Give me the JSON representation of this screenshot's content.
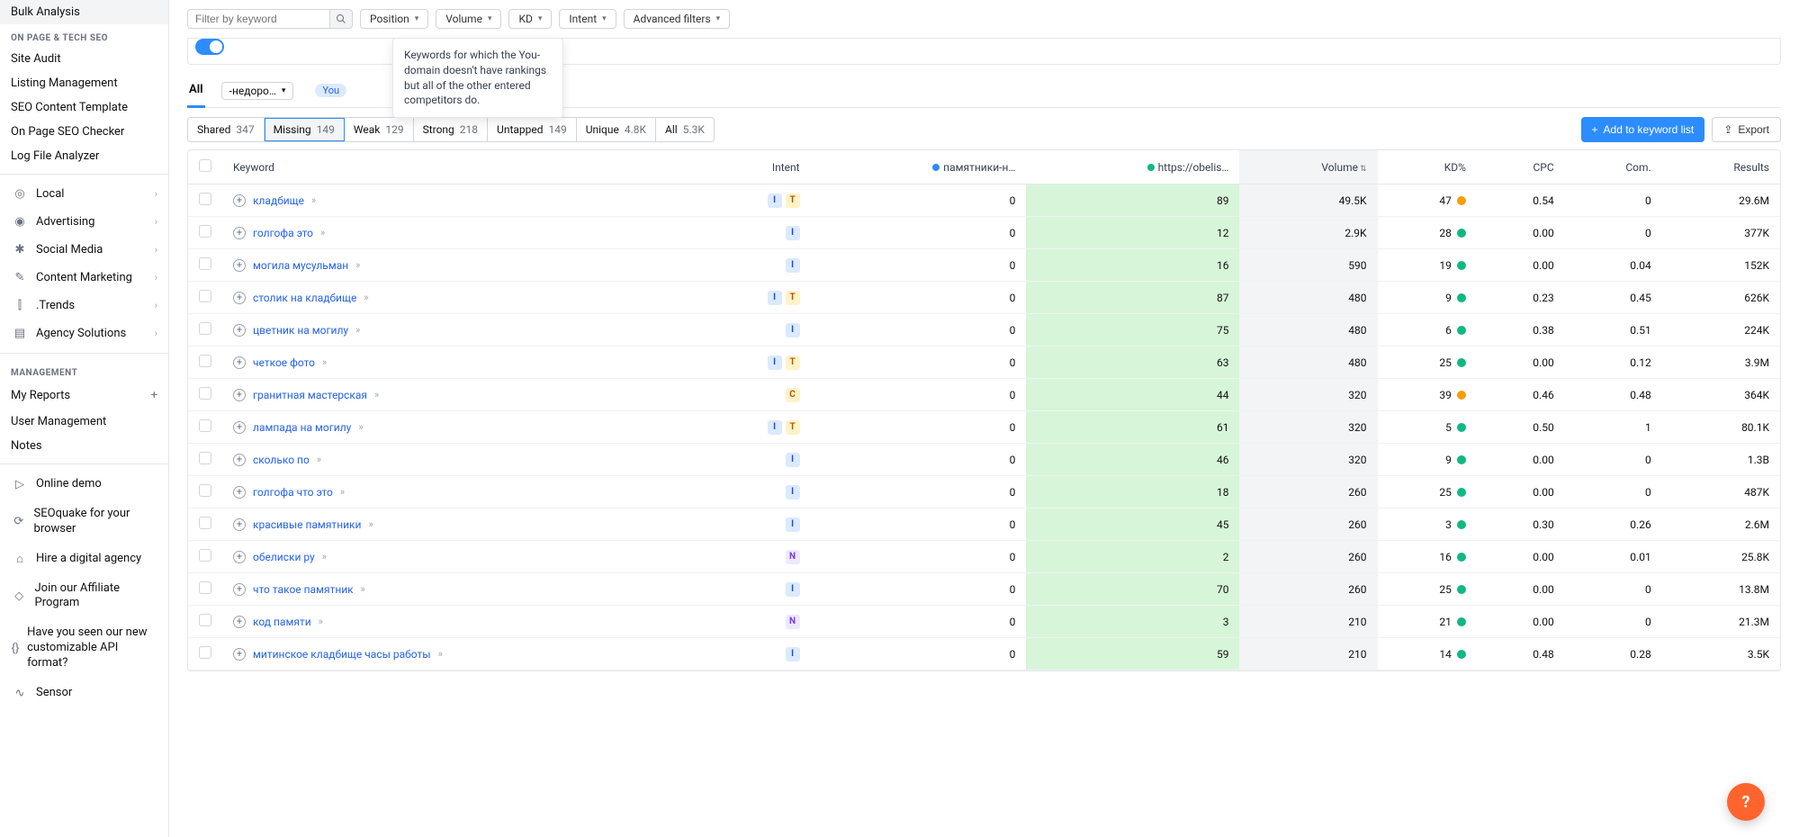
{
  "sidebar": {
    "top_items": [
      "Bulk Analysis"
    ],
    "section1_heading": "ON PAGE & TECH SEO",
    "section1_items": [
      "Site Audit",
      "Listing Management",
      "SEO Content Template",
      "On Page SEO Checker",
      "Log File Analyzer"
    ],
    "main_sections": [
      {
        "label": "Local",
        "icon": "pin"
      },
      {
        "label": "Advertising",
        "icon": "target"
      },
      {
        "label": "Social Media",
        "icon": "share"
      },
      {
        "label": "Content Marketing",
        "icon": "pencil"
      },
      {
        "label": ".Trends",
        "icon": "chart"
      },
      {
        "label": "Agency Solutions",
        "icon": "doc"
      }
    ],
    "management_heading": "MANAGEMENT",
    "management_items": [
      "My Reports",
      "User Management",
      "Notes"
    ],
    "footer_items": [
      "Online demo",
      "SEOquake for your browser",
      "Hire a digital agency",
      "Join our Affiliate Program",
      "Have you seen our new customizable API format?",
      "Sensor"
    ]
  },
  "toolbar": {
    "filter_placeholder": "Filter by keyword",
    "pills": [
      "Position",
      "Volume",
      "KD",
      "Intent",
      "Advanced filters"
    ]
  },
  "tooltip_text": "Keywords for which the You-domain doesn't have rankings but all of the other entered competitors do.",
  "tabs": {
    "all_label": "All",
    "domain_label": "-недоро…",
    "you_label": "You"
  },
  "segments": [
    {
      "label": "Shared",
      "count": "347"
    },
    {
      "label": "Missing",
      "count": "149"
    },
    {
      "label": "Weak",
      "count": "129"
    },
    {
      "label": "Strong",
      "count": "218"
    },
    {
      "label": "Untapped",
      "count": "149"
    },
    {
      "label": "Unique",
      "count": "4.8K"
    },
    {
      "label": "All",
      "count": "5.3K"
    }
  ],
  "actions": {
    "add_label": "Add to keyword list",
    "export_label": "Export"
  },
  "columns": {
    "keyword": "Keyword",
    "intent": "Intent",
    "comp1": "памятники-н…",
    "comp2": "https://obelis…",
    "volume": "Volume",
    "kd": "KD%",
    "cpc": "CPC",
    "com": "Com.",
    "results": "Results"
  },
  "rows": [
    {
      "kw": "кладбище",
      "intent": [
        "I",
        "T"
      ],
      "c1": "0",
      "c2": "89",
      "vol": "49.5K",
      "kd": "47",
      "kdc": "yellow",
      "cpc": "0.54",
      "com": "0",
      "res": "29.6M"
    },
    {
      "kw": "голгофа это",
      "intent": [
        "I"
      ],
      "c1": "0",
      "c2": "12",
      "vol": "2.9K",
      "kd": "28",
      "kdc": "green",
      "cpc": "0.00",
      "com": "0",
      "res": "377K"
    },
    {
      "kw": "могила мусульман",
      "intent": [
        "I"
      ],
      "c1": "0",
      "c2": "16",
      "vol": "590",
      "kd": "19",
      "kdc": "green",
      "cpc": "0.00",
      "com": "0.04",
      "res": "152K"
    },
    {
      "kw": "столик на кладбище",
      "intent": [
        "I",
        "T"
      ],
      "c1": "0",
      "c2": "87",
      "vol": "480",
      "kd": "9",
      "kdc": "green",
      "cpc": "0.23",
      "com": "0.45",
      "res": "626K"
    },
    {
      "kw": "цветник на могилу",
      "intent": [
        "I"
      ],
      "c1": "0",
      "c2": "75",
      "vol": "480",
      "kd": "6",
      "kdc": "green",
      "cpc": "0.38",
      "com": "0.51",
      "res": "224K"
    },
    {
      "kw": "четкое фото",
      "intent": [
        "I",
        "T"
      ],
      "c1": "0",
      "c2": "63",
      "vol": "480",
      "kd": "25",
      "kdc": "green",
      "cpc": "0.00",
      "com": "0.12",
      "res": "3.9M"
    },
    {
      "kw": "гранитная мастерская",
      "intent": [
        "C"
      ],
      "c1": "0",
      "c2": "44",
      "vol": "320",
      "kd": "39",
      "kdc": "yellow",
      "cpc": "0.46",
      "com": "0.48",
      "res": "364K"
    },
    {
      "kw": "лампада на могилу",
      "intent": [
        "I",
        "T"
      ],
      "c1": "0",
      "c2": "61",
      "vol": "320",
      "kd": "5",
      "kdc": "green",
      "cpc": "0.50",
      "com": "1",
      "res": "80.1K"
    },
    {
      "kw": "сколько по",
      "intent": [
        "I"
      ],
      "c1": "0",
      "c2": "46",
      "vol": "320",
      "kd": "9",
      "kdc": "green",
      "cpc": "0.00",
      "com": "0",
      "res": "1.3B"
    },
    {
      "kw": "голгофа что это",
      "intent": [
        "I"
      ],
      "c1": "0",
      "c2": "18",
      "vol": "260",
      "kd": "25",
      "kdc": "green",
      "cpc": "0.00",
      "com": "0",
      "res": "487K"
    },
    {
      "kw": "красивые памятники",
      "intent": [
        "I"
      ],
      "c1": "0",
      "c2": "45",
      "vol": "260",
      "kd": "3",
      "kdc": "green",
      "cpc": "0.30",
      "com": "0.26",
      "res": "2.6M"
    },
    {
      "kw": "обелиски ру",
      "intent": [
        "N"
      ],
      "c1": "0",
      "c2": "2",
      "vol": "260",
      "kd": "16",
      "kdc": "green",
      "cpc": "0.00",
      "com": "0.01",
      "res": "25.8K"
    },
    {
      "kw": "что такое памятник",
      "intent": [
        "I"
      ],
      "c1": "0",
      "c2": "70",
      "vol": "260",
      "kd": "25",
      "kdc": "green",
      "cpc": "0.00",
      "com": "0",
      "res": "13.8M"
    },
    {
      "kw": "код памяти",
      "intent": [
        "N"
      ],
      "c1": "0",
      "c2": "3",
      "vol": "210",
      "kd": "21",
      "kdc": "green",
      "cpc": "0.00",
      "com": "0",
      "res": "21.3M"
    },
    {
      "kw": "митинское кладбище часы работы",
      "intent": [
        "I"
      ],
      "c1": "0",
      "c2": "59",
      "vol": "210",
      "kd": "14",
      "kdc": "green",
      "cpc": "0.48",
      "com": "0.28",
      "res": "3.5K"
    }
  ]
}
